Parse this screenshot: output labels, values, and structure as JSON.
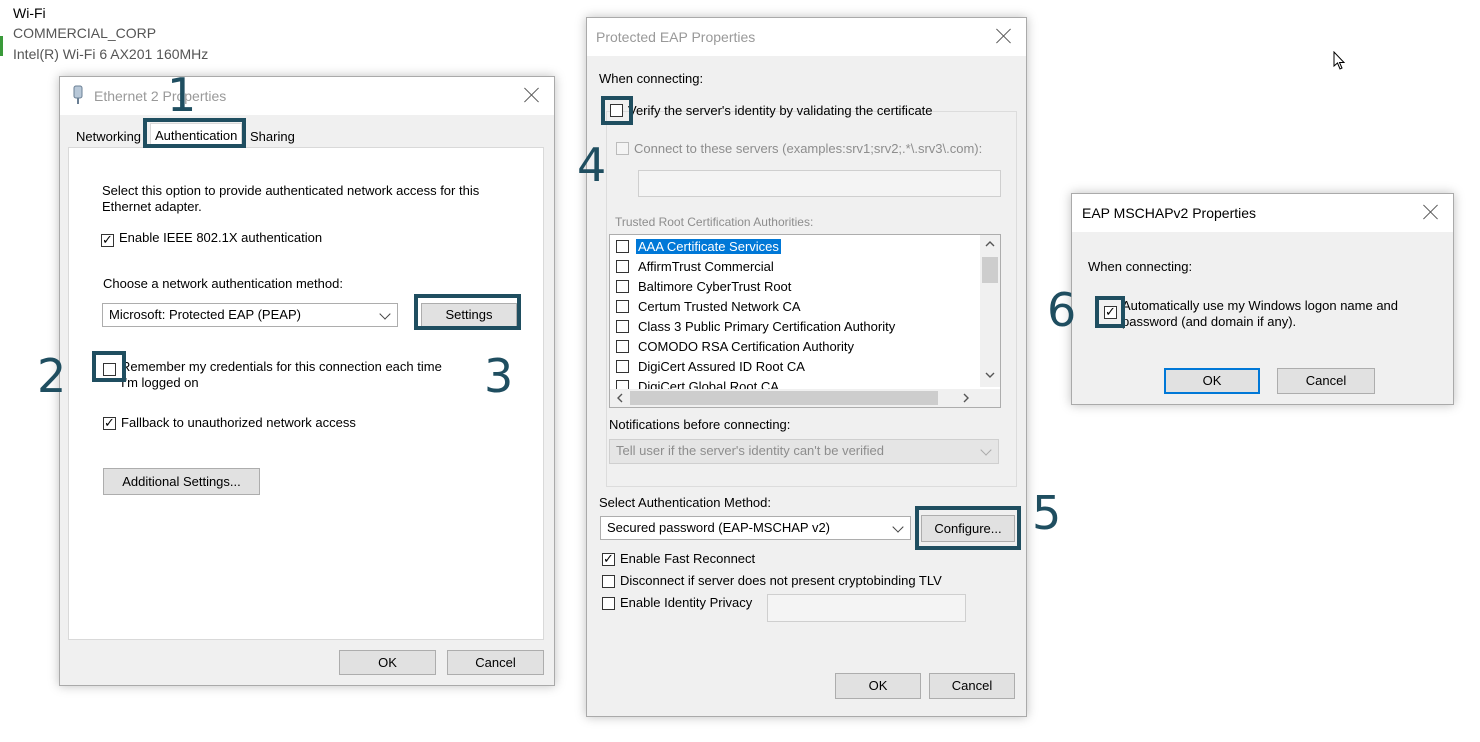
{
  "background": {
    "network_name": "Wi-Fi",
    "network_ssid": "COMMERCIAL_CORP",
    "adapter_name": "Intel(R) Wi-Fi 6 AX201 160MHz"
  },
  "eth": {
    "title": "Ethernet 2 Properties",
    "tabs": [
      "Networking",
      "Authentication",
      "Sharing"
    ],
    "description": "Select this option to provide authenticated network access for this Ethernet adapter.",
    "enable_8021x": "Enable IEEE 802.1X authentication",
    "choose_method": "Choose a network authentication method:",
    "method_value": "Microsoft: Protected EAP (PEAP)",
    "settings": "Settings",
    "remember": "Remember my credentials for this connection each time I'm logged on",
    "fallback": "Fallback to unauthorized network access",
    "additional": "Additional Settings...",
    "ok": "OK",
    "cancel": "Cancel"
  },
  "peap": {
    "title": "Protected EAP Properties",
    "when_connecting": "When connecting:",
    "verify": "Verify the server's identity by validating the certificate",
    "connect_servers": "Connect to these servers (examples:srv1;srv2;.*\\.srv3\\.com):",
    "servers_value": "",
    "trusted_root": "Trusted Root Certification Authorities:",
    "cas": [
      "AAA Certificate Services",
      "AffirmTrust Commercial",
      "Baltimore CyberTrust Root",
      "Certum Trusted Network CA",
      "Class 3 Public Primary Certification Authority",
      "COMODO RSA Certification Authority",
      "DigiCert Assured ID Root CA",
      "DigiCert Global Root CA"
    ],
    "notifications": "Notifications before connecting:",
    "notify_value": "Tell user if the server's identity can't be verified",
    "select_auth": "Select Authentication Method:",
    "auth_value": "Secured password (EAP-MSCHAP v2)",
    "configure": "Configure...",
    "fast_reconnect": "Enable Fast Reconnect",
    "cryptobinding": "Disconnect if server does not present cryptobinding TLV",
    "identity_privacy": "Enable Identity Privacy",
    "identity_value": "",
    "ok": "OK",
    "cancel": "Cancel"
  },
  "mschap": {
    "title": "EAP MSCHAPv2 Properties",
    "when_connecting": "When connecting:",
    "auto_logon": "Automatically use my Windows logon name and password (and domain if any).",
    "ok": "OK",
    "cancel": "Cancel"
  },
  "annotations": [
    "1",
    "2",
    "3",
    "4",
    "5",
    "6"
  ],
  "colors": {
    "highlight": "#1f4e60",
    "selection": "#0078d7"
  }
}
